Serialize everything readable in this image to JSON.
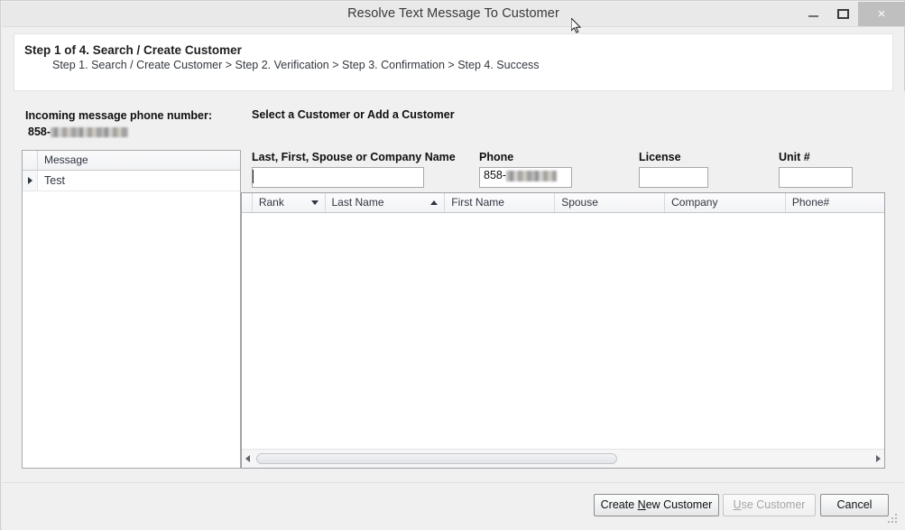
{
  "window": {
    "title": "Resolve Text Message To Customer",
    "controls": {
      "minimize": "–",
      "maximize": "❐",
      "close": "×"
    }
  },
  "header": {
    "step_title": "Step 1 of 4. Search / Create Customer",
    "breadcrumb": "Step 1. Search / Create Customer  > Step 2. Verification > Step 3. Confirmation > Step 4. Success"
  },
  "left_panel": {
    "incoming_label": "Incoming message phone number:",
    "incoming_number_prefix": "858-",
    "incoming_number_redacted": true,
    "message_grid": {
      "columns": [
        "Message"
      ],
      "rows": [
        {
          "message": "Test",
          "selected": true
        }
      ]
    }
  },
  "right_panel": {
    "section_title": "Select a Customer or Add a Customer",
    "fields": [
      {
        "name": "name",
        "label": "Last, First, Spouse or Company Name",
        "value": "",
        "placeholder": "",
        "focused": true
      },
      {
        "name": "phone",
        "label": "Phone",
        "value": "858-",
        "value_redacted": true,
        "placeholder": ""
      },
      {
        "name": "license",
        "label": "License",
        "value": "",
        "placeholder": ""
      },
      {
        "name": "unit",
        "label": "Unit #",
        "value": "",
        "placeholder": ""
      }
    ],
    "results_grid": {
      "columns": [
        {
          "label": "Rank",
          "sort": "down"
        },
        {
          "label": "Last Name",
          "sort": "up"
        },
        {
          "label": "First Name",
          "sort": "none"
        },
        {
          "label": "Spouse",
          "sort": "none"
        },
        {
          "label": "Company",
          "sort": "none"
        },
        {
          "label": "Phone#",
          "sort": "none"
        }
      ],
      "rows": [],
      "scrollbar": {
        "left_arrow": "◀",
        "right_arrow": "▶"
      }
    }
  },
  "footer": {
    "buttons": [
      {
        "name": "create-new-customer",
        "label_before": "Create ",
        "accel": "N",
        "label_after": "ew Customer",
        "enabled": true
      },
      {
        "name": "use-customer",
        "label_before": "",
        "accel": "U",
        "label_after": "se Customer",
        "enabled": false
      },
      {
        "name": "cancel",
        "label_before": "Cancel",
        "accel": "",
        "label_after": "",
        "enabled": true
      }
    ]
  },
  "colors": {
    "window_bg": "#f0f0f0",
    "titlebar_bg": "#e9e9e9",
    "panel_white": "#ffffff",
    "close_hover": "#bfbfbf",
    "grid_border": "#9ea0a6",
    "text": "#0f0f0f"
  }
}
